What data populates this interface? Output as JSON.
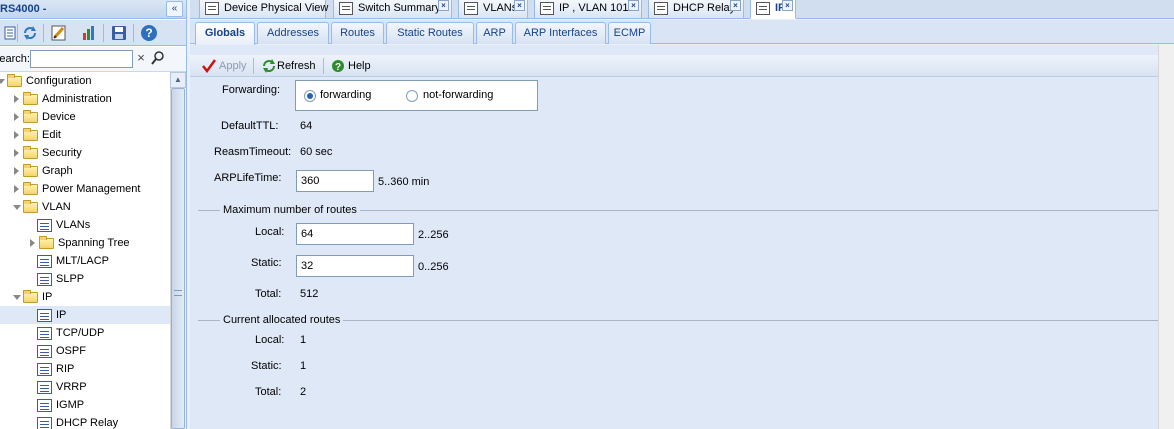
{
  "left_panel": {
    "title": "RS4000 -",
    "collapse_glyph": "«",
    "search": {
      "label": "Search:",
      "value": "",
      "clear_glyph": "×",
      "go_glyph": "⚲"
    },
    "toolbar_icons": [
      "tree-view-icon",
      "refresh-icon",
      "edit-icon",
      "graph-icon",
      "save-icon",
      "help-icon"
    ],
    "tree": [
      {
        "label": "Configuration",
        "type": "folder",
        "expanded": true
      },
      {
        "label": "Administration",
        "type": "folder",
        "expanded": false
      },
      {
        "label": "Device",
        "type": "folder",
        "expanded": false
      },
      {
        "label": "Edit",
        "type": "folder",
        "expanded": false
      },
      {
        "label": "Security",
        "type": "folder",
        "expanded": false
      },
      {
        "label": "Graph",
        "type": "folder",
        "expanded": false
      },
      {
        "label": "Power Management",
        "type": "folder",
        "expanded": false
      },
      {
        "label": "VLAN",
        "type": "folder",
        "expanded": true
      },
      {
        "label": "VLANs",
        "type": "leaf"
      },
      {
        "label": "Spanning Tree",
        "type": "folder",
        "expanded": false
      },
      {
        "label": "MLT/LACP",
        "type": "leaf"
      },
      {
        "label": "SLPP",
        "type": "leaf"
      },
      {
        "label": "IP",
        "type": "folder",
        "expanded": true
      },
      {
        "label": "IP",
        "type": "leaf",
        "selected": true
      },
      {
        "label": "TCP/UDP",
        "type": "leaf"
      },
      {
        "label": "OSPF",
        "type": "leaf"
      },
      {
        "label": "RIP",
        "type": "leaf"
      },
      {
        "label": "VRRP",
        "type": "leaf"
      },
      {
        "label": "IGMP",
        "type": "leaf"
      },
      {
        "label": "DHCP Relay",
        "type": "leaf"
      }
    ]
  },
  "top_tabs": [
    {
      "label": "Device Physical View",
      "active": false,
      "closable": false
    },
    {
      "label": "Switch Summary",
      "active": false,
      "closable": true
    },
    {
      "label": "VLANs",
      "active": false,
      "closable": true
    },
    {
      "label": "IP , VLAN 101",
      "active": false,
      "closable": true
    },
    {
      "label": "DHCP Relay",
      "active": false,
      "closable": true
    },
    {
      "label": "IP",
      "active": true,
      "closable": true
    }
  ],
  "close_glyph": "×",
  "inner_tabs": [
    {
      "label": "Globals",
      "active": true
    },
    {
      "label": "Addresses",
      "active": false
    },
    {
      "label": "Routes",
      "active": false
    },
    {
      "label": "Static Routes",
      "active": false
    },
    {
      "label": "ARP",
      "active": false
    },
    {
      "label": "ARP Interfaces",
      "active": false
    },
    {
      "label": "ECMP",
      "active": false
    }
  ],
  "content_toolbar": {
    "apply": "Apply",
    "refresh": "Refresh",
    "help": "Help"
  },
  "form": {
    "forwarding": {
      "label": "Forwarding:",
      "options": [
        "forwarding",
        "not-forwarding"
      ],
      "selected": "forwarding"
    },
    "default_ttl": {
      "label": "DefaultTTL:",
      "value": "64"
    },
    "reasm_timeout": {
      "label": "ReasmTimeout:",
      "value": "60 sec"
    },
    "arp_life_time": {
      "label": "ARPLifeTime:",
      "value": "360",
      "range": "5..360 min"
    },
    "max_routes": {
      "legend": "Maximum number of routes",
      "local": {
        "label": "Local:",
        "value": "64",
        "range": "2..256"
      },
      "static": {
        "label": "Static:",
        "value": "32",
        "range": "0..256"
      },
      "total": {
        "label": "Total:",
        "value": "512"
      }
    },
    "current_routes": {
      "legend": "Current allocated routes",
      "local": {
        "label": "Local:",
        "value": "1"
      },
      "static": {
        "label": "Static:",
        "value": "1"
      },
      "total": {
        "label": "Total:",
        "value": "2"
      }
    }
  },
  "colors": {
    "accent": "#15428b",
    "panel_bg": "#dfe8f6",
    "border": "#99bbe8",
    "apply_check": "#cc1111",
    "refresh_icon": "#2e8b2e",
    "help_icon": "#2e8b2e"
  }
}
